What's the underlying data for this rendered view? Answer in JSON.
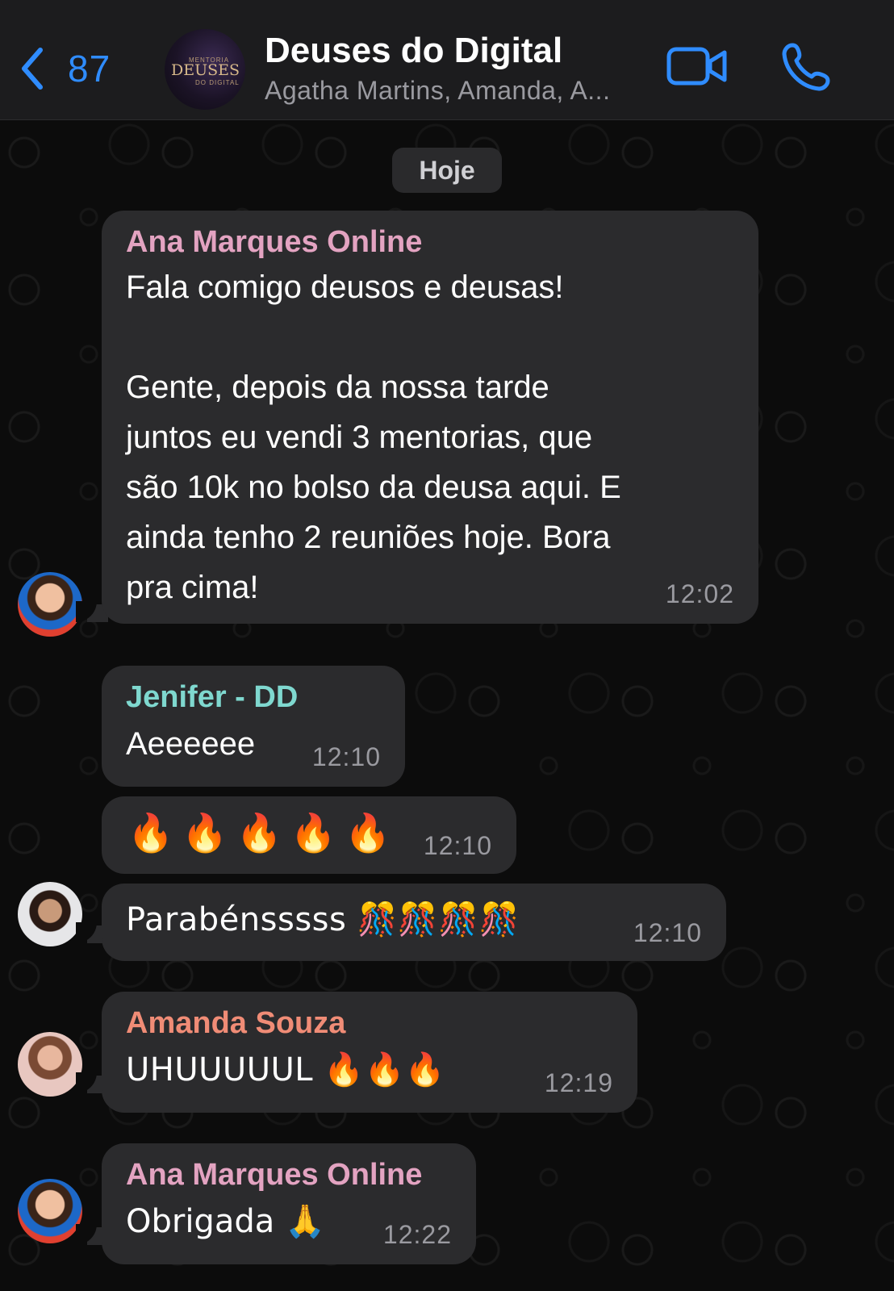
{
  "header": {
    "back_count": "87",
    "group_name": "Deuses do Digital",
    "members": "Agatha Martins, Amanda, A...",
    "avatar_logo_small": "MENTORIA",
    "avatar_logo_main": "DEUSES",
    "avatar_logo_sub": "DO DIGITAL"
  },
  "chat": {
    "date_chip": "Hoje",
    "messages": [
      {
        "sender": "Ana Marques Online",
        "sender_color": "#e3a3c1",
        "text": "Fala comigo deusos e deusas!\n\nGente, depois da nossa tarde\njuntos eu vendi 3 mentorias, que\nsão 10k no bolso da deusa aqui. E\nainda tenho 2 reuniões hoje. Bora\npra cima!",
        "time": "12:02"
      },
      {
        "sender": "Jenifer - DD",
        "sender_color": "#7fd8cf",
        "text": "Aeeeeee",
        "time": "12:10"
      },
      {
        "sender": "",
        "text": "🔥🔥🔥🔥🔥",
        "time": "12:10"
      },
      {
        "sender": "",
        "text": "Parabénsssss 🎊🎊🎊🎊",
        "time": "12:10"
      },
      {
        "sender": "Amanda Souza",
        "sender_color": "#f08c76",
        "text": "UHUUUUUL 🔥🔥🔥",
        "time": "12:19"
      },
      {
        "sender": "Ana Marques Online",
        "sender_color": "#e3a3c1",
        "text": "Obrigada 🙏",
        "time": "12:22"
      }
    ]
  },
  "colors": {
    "accent": "#2f8cff",
    "bubble": "#2b2b2d",
    "header_bg": "#1c1c1e"
  }
}
